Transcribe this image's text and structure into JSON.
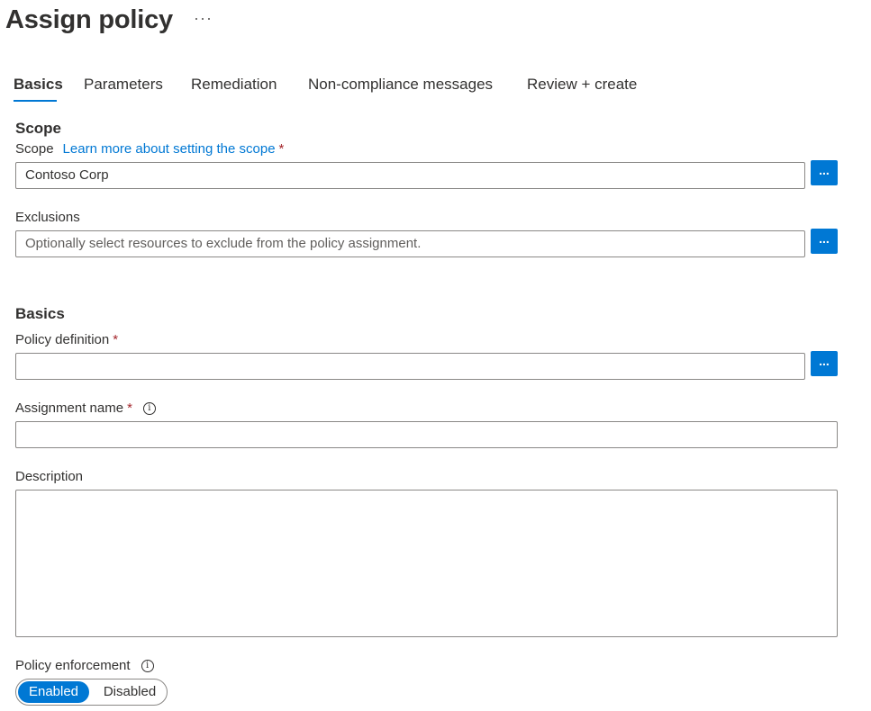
{
  "page": {
    "title": "Assign policy",
    "more_label": "···"
  },
  "tabs": [
    {
      "label": "Basics",
      "active": true
    },
    {
      "label": "Parameters"
    },
    {
      "label": "Remediation"
    },
    {
      "label": "Non-compliance messages"
    },
    {
      "label": "Review + create"
    }
  ],
  "scope_section": {
    "heading": "Scope",
    "scope_label": "Scope",
    "scope_link": "Learn more about setting the scope",
    "required_mark": "*",
    "scope_value": "Contoso Corp",
    "browse_label": "...",
    "exclusions_label": "Exclusions",
    "exclusions_placeholder": "Optionally select resources to exclude from the policy assignment."
  },
  "basics_section": {
    "heading": "Basics",
    "policy_definition_label": "Policy definition",
    "policy_definition_value": "",
    "assignment_name_label": "Assignment name",
    "assignment_name_value": "",
    "description_label": "Description",
    "description_value": "",
    "enforcement_label": "Policy enforcement",
    "enforcement_options": [
      "Enabled",
      "Disabled"
    ],
    "enforcement_selected": "Enabled"
  },
  "icons": {
    "info": "info-icon",
    "more": "more-horizontal-icon"
  },
  "colors": {
    "accent": "#0078d4",
    "required": "#a4262c",
    "border": "#8a8886",
    "text": "#323130"
  }
}
